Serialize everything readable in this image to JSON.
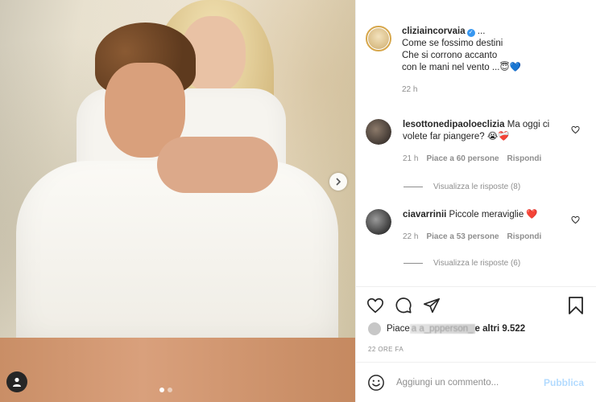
{
  "post": {
    "author": "cliziaincorvaia",
    "more": "...",
    "caption_lines": [
      "Come se fossimo destini",
      "Che si corrono accanto",
      "con le mani nel vento ...😇💙"
    ],
    "time": "22 h"
  },
  "comments": [
    {
      "username": "lesottonedipaoloeclizia",
      "text": "Ma oggi ci volete far piangere? 😭❤️‍🩹",
      "time": "21 h",
      "likes": "Piace a 60 persone",
      "reply": "Rispondi",
      "view_replies": "Visualizza le risposte (8)"
    },
    {
      "username": "ciavarrinii",
      "text": "Piccole meraviglie ❤️",
      "time": "22 h",
      "likes": "Piace a 53 persone",
      "reply": "Rispondi",
      "view_replies": "Visualizza le risposte (6)"
    }
  ],
  "likes_summary": {
    "prefix": "Piace ",
    "blurred": "a a_ppperson_",
    "suffix": " e altri 9.522"
  },
  "timestamp": "22 ORE FA",
  "add_comment": {
    "placeholder": "Aggiungi un commento...",
    "publish": "Pubblica"
  },
  "colors": {
    "story_ring": "#d6a64a",
    "verified": "#3897f0",
    "publish_disabled": "#b3dbff"
  },
  "icons": {
    "like": "heart-icon",
    "comment": "comment-icon",
    "share": "share-icon",
    "save": "bookmark-icon",
    "emoji": "emoji-icon",
    "next": "chevron-right-icon",
    "tags": "user-tag-icon"
  }
}
